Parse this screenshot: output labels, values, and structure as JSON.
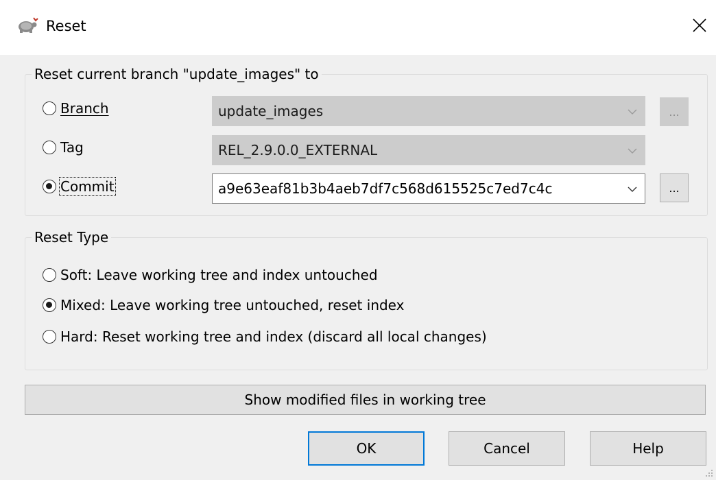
{
  "window": {
    "title": "Reset"
  },
  "target_group": {
    "label": "Reset current branch \"update_images\" to",
    "branch": {
      "label": "Branch",
      "value": "update_images",
      "browse_label": "..."
    },
    "tag": {
      "label": "Tag",
      "value": "REL_2.9.0.0_EXTERNAL"
    },
    "commit": {
      "label": "Commit",
      "value": "a9e63eaf81b3b4aeb7df7c568d615525c7ed7c4c",
      "browse_label": "..."
    },
    "selected": "commit"
  },
  "reset_type_group": {
    "label": "Reset Type",
    "options": [
      {
        "label": "Soft: Leave working tree and index untouched",
        "checked": false
      },
      {
        "label": "Mixed: Leave working tree untouched, reset index",
        "checked": true
      },
      {
        "label": "Hard: Reset working tree and index (discard all local changes)",
        "checked": false
      }
    ]
  },
  "buttons": {
    "show_modified": "Show modified files in working tree",
    "ok": "OK",
    "cancel": "Cancel",
    "help": "Help"
  },
  "colors": {
    "dialog_bg": "#f0f0f0",
    "default_button_border": "#0078d7",
    "disabled_field_bg": "#cccccc"
  },
  "icons": {
    "app": "tortoisegit-icon",
    "close": "close-icon",
    "dropdown": "chevron-down-icon"
  }
}
